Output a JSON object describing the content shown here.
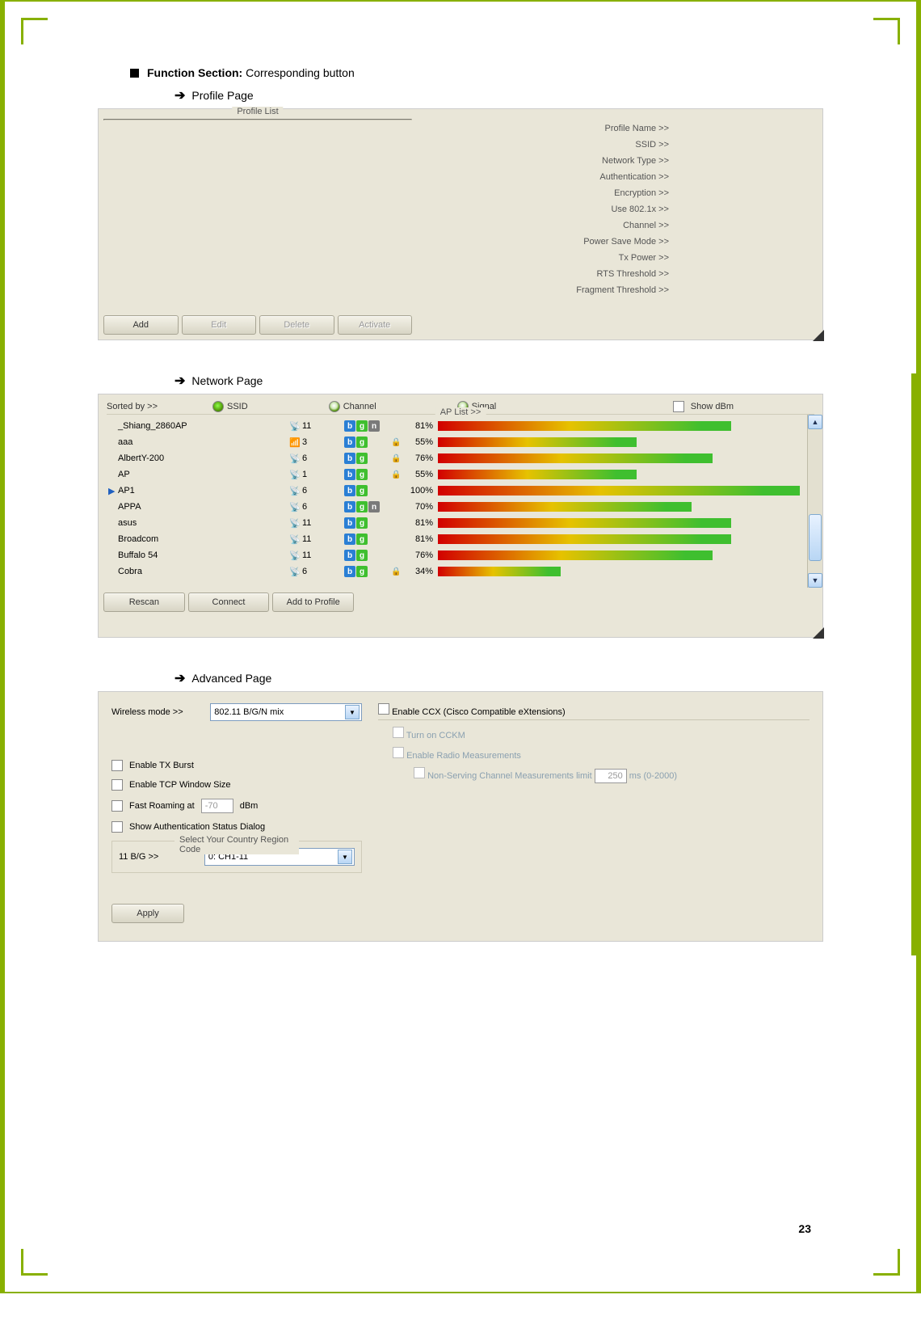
{
  "doc": {
    "section_title_bold": "Function Section:",
    "section_title_rest": " Corresponding button",
    "profile_page_label": "Profile Page",
    "network_page_label": "Network Page",
    "advanced_page_label": "Advanced Page",
    "page_number": "23"
  },
  "profile": {
    "fieldset_label": "Profile List",
    "buttons": {
      "add": "Add",
      "edit": "Edit",
      "delete": "Delete",
      "activate": "Activate"
    },
    "details": {
      "profile_name": "Profile Name >>",
      "ssid": "SSID >>",
      "network_type": "Network Type >>",
      "authentication": "Authentication >>",
      "encryption": "Encryption >>",
      "use_8021x": "Use 802.1x >>",
      "channel": "Channel >>",
      "power_save": "Power Save Mode >>",
      "tx_power": "Tx Power >>",
      "rts": "RTS Threshold >>",
      "fragment": "Fragment Threshold >>"
    }
  },
  "network": {
    "sorted_by": "Sorted by >>",
    "sort_ssid": "SSID",
    "sort_channel": "Channel",
    "sort_signal": "Signal",
    "show_dbm": "Show dBm",
    "ap_list_label": "AP List >>",
    "buttons": {
      "rescan": "Rescan",
      "connect": "Connect",
      "add_profile": "Add to Profile"
    },
    "rows": [
      {
        "name": "_Shiang_2860AP",
        "ch": "11",
        "modes": [
          "b",
          "g",
          "n"
        ],
        "lock": false,
        "sig": "81%",
        "pct": 81,
        "icon": "ant",
        "selected": false
      },
      {
        "name": "aaa",
        "ch": "3",
        "modes": [
          "b",
          "g"
        ],
        "lock": true,
        "sig": "55%",
        "pct": 55,
        "icon": "dev",
        "selected": false
      },
      {
        "name": "AlbertY-200",
        "ch": "6",
        "modes": [
          "b",
          "g"
        ],
        "lock": true,
        "sig": "76%",
        "pct": 76,
        "icon": "ant",
        "selected": false
      },
      {
        "name": "AP",
        "ch": "1",
        "modes": [
          "b",
          "g"
        ],
        "lock": true,
        "sig": "55%",
        "pct": 55,
        "icon": "ant",
        "selected": false
      },
      {
        "name": "AP1",
        "ch": "6",
        "modes": [
          "b",
          "g"
        ],
        "lock": false,
        "sig": "100%",
        "pct": 100,
        "icon": "ant",
        "selected": true
      },
      {
        "name": "APPA",
        "ch": "6",
        "modes": [
          "b",
          "g",
          "n"
        ],
        "lock": false,
        "sig": "70%",
        "pct": 70,
        "icon": "ant",
        "selected": false
      },
      {
        "name": "asus",
        "ch": "11",
        "modes": [
          "b",
          "g"
        ],
        "lock": false,
        "sig": "81%",
        "pct": 81,
        "icon": "ant",
        "selected": false
      },
      {
        "name": "Broadcom",
        "ch": "11",
        "modes": [
          "b",
          "g"
        ],
        "lock": false,
        "sig": "81%",
        "pct": 81,
        "icon": "ant",
        "selected": false
      },
      {
        "name": "Buffalo 54",
        "ch": "11",
        "modes": [
          "b",
          "g"
        ],
        "lock": false,
        "sig": "76%",
        "pct": 76,
        "icon": "ant",
        "selected": false
      },
      {
        "name": "Cobra",
        "ch": "6",
        "modes": [
          "b",
          "g"
        ],
        "lock": true,
        "sig": "34%",
        "pct": 34,
        "icon": "ant",
        "selected": false
      }
    ]
  },
  "advanced": {
    "wireless_mode_label": "Wireless mode >>",
    "wireless_mode_value": "802.11 B/G/N mix",
    "enable_tx_burst": "Enable TX Burst",
    "enable_tcp_win": "Enable TCP Window Size",
    "fast_roaming_pre": "Fast Roaming at",
    "fast_roaming_val": "-70",
    "fast_roaming_post": "dBm",
    "show_auth_dialog": "Show Authentication Status Dialog",
    "region_label": "Select Your Country Region Code",
    "bg_label": "11 B/G >>",
    "bg_value": "0: CH1-11",
    "apply": "Apply",
    "ccx_enable": "Enable CCX (Cisco Compatible eXtensions)",
    "ccx_cckm": "Turn on CCKM",
    "ccx_radio": "Enable Radio Measurements",
    "ccx_nonserv": "Non-Serving Channel Measurements limit",
    "ccx_nonserv_val": "250",
    "ccx_nonserv_unit": "ms (0-2000)"
  }
}
